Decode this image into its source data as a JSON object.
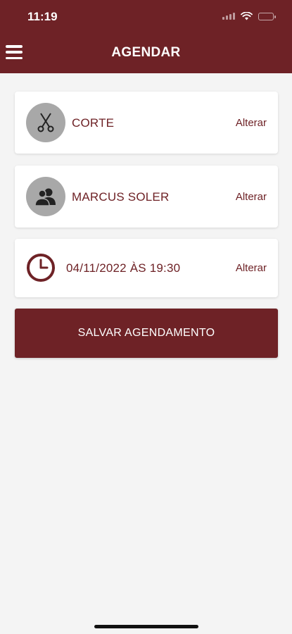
{
  "status_bar": {
    "time": "11:19"
  },
  "header": {
    "title": "AGENDAR",
    "menu_icon": "hamburger-menu-icon"
  },
  "service": {
    "label": "CORTE",
    "action": "Alterar",
    "icon": "scissors-icon"
  },
  "professional": {
    "label": "MARCUS SOLER",
    "action": "Alterar",
    "icon": "users-icon"
  },
  "datetime": {
    "label": "04/11/2022 ÀS 19:30",
    "action": "Alterar",
    "icon": "clock-icon"
  },
  "save_button": {
    "label": "SALVAR AGENDAMENTO"
  },
  "colors": {
    "primary": "#6e2226",
    "background": "#f4f4f4",
    "icon_circle": "#a8a8a8"
  }
}
